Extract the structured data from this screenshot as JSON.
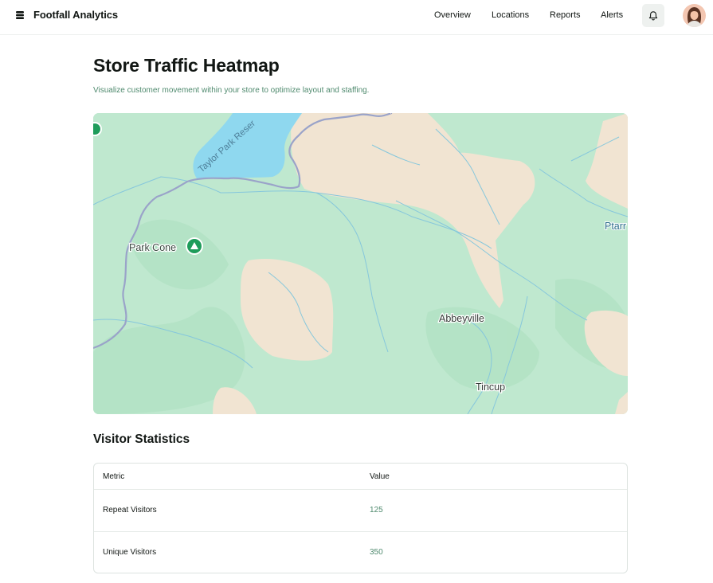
{
  "app": {
    "name": "Footfall Analytics"
  },
  "nav": {
    "items": [
      {
        "label": "Overview"
      },
      {
        "label": "Locations"
      },
      {
        "label": "Reports"
      },
      {
        "label": "Alerts"
      }
    ]
  },
  "header": {
    "title": "Store Traffic Heatmap",
    "subtitle": "Visualize customer movement within your store to optimize layout and staffing."
  },
  "map": {
    "labels": {
      "reservoir": "Taylor Park Reser",
      "peak": "Park Cone",
      "town1": "Abbeyville",
      "town2": "Tincup",
      "edge": "Ptarr"
    },
    "colors": {
      "forest": "#bfe8cf",
      "open_land": "#f1e4d2",
      "water": "#8fd8ef",
      "boundary": "#9aa3c9",
      "stream": "#86c7dc",
      "park_marker": "#1e9c5a"
    }
  },
  "stats": {
    "title": "Visitor Statistics",
    "columns": [
      "Metric",
      "Value"
    ],
    "rows": [
      {
        "metric": "Repeat Visitors",
        "value": "125"
      },
      {
        "metric": "Unique Visitors",
        "value": "350"
      }
    ]
  }
}
